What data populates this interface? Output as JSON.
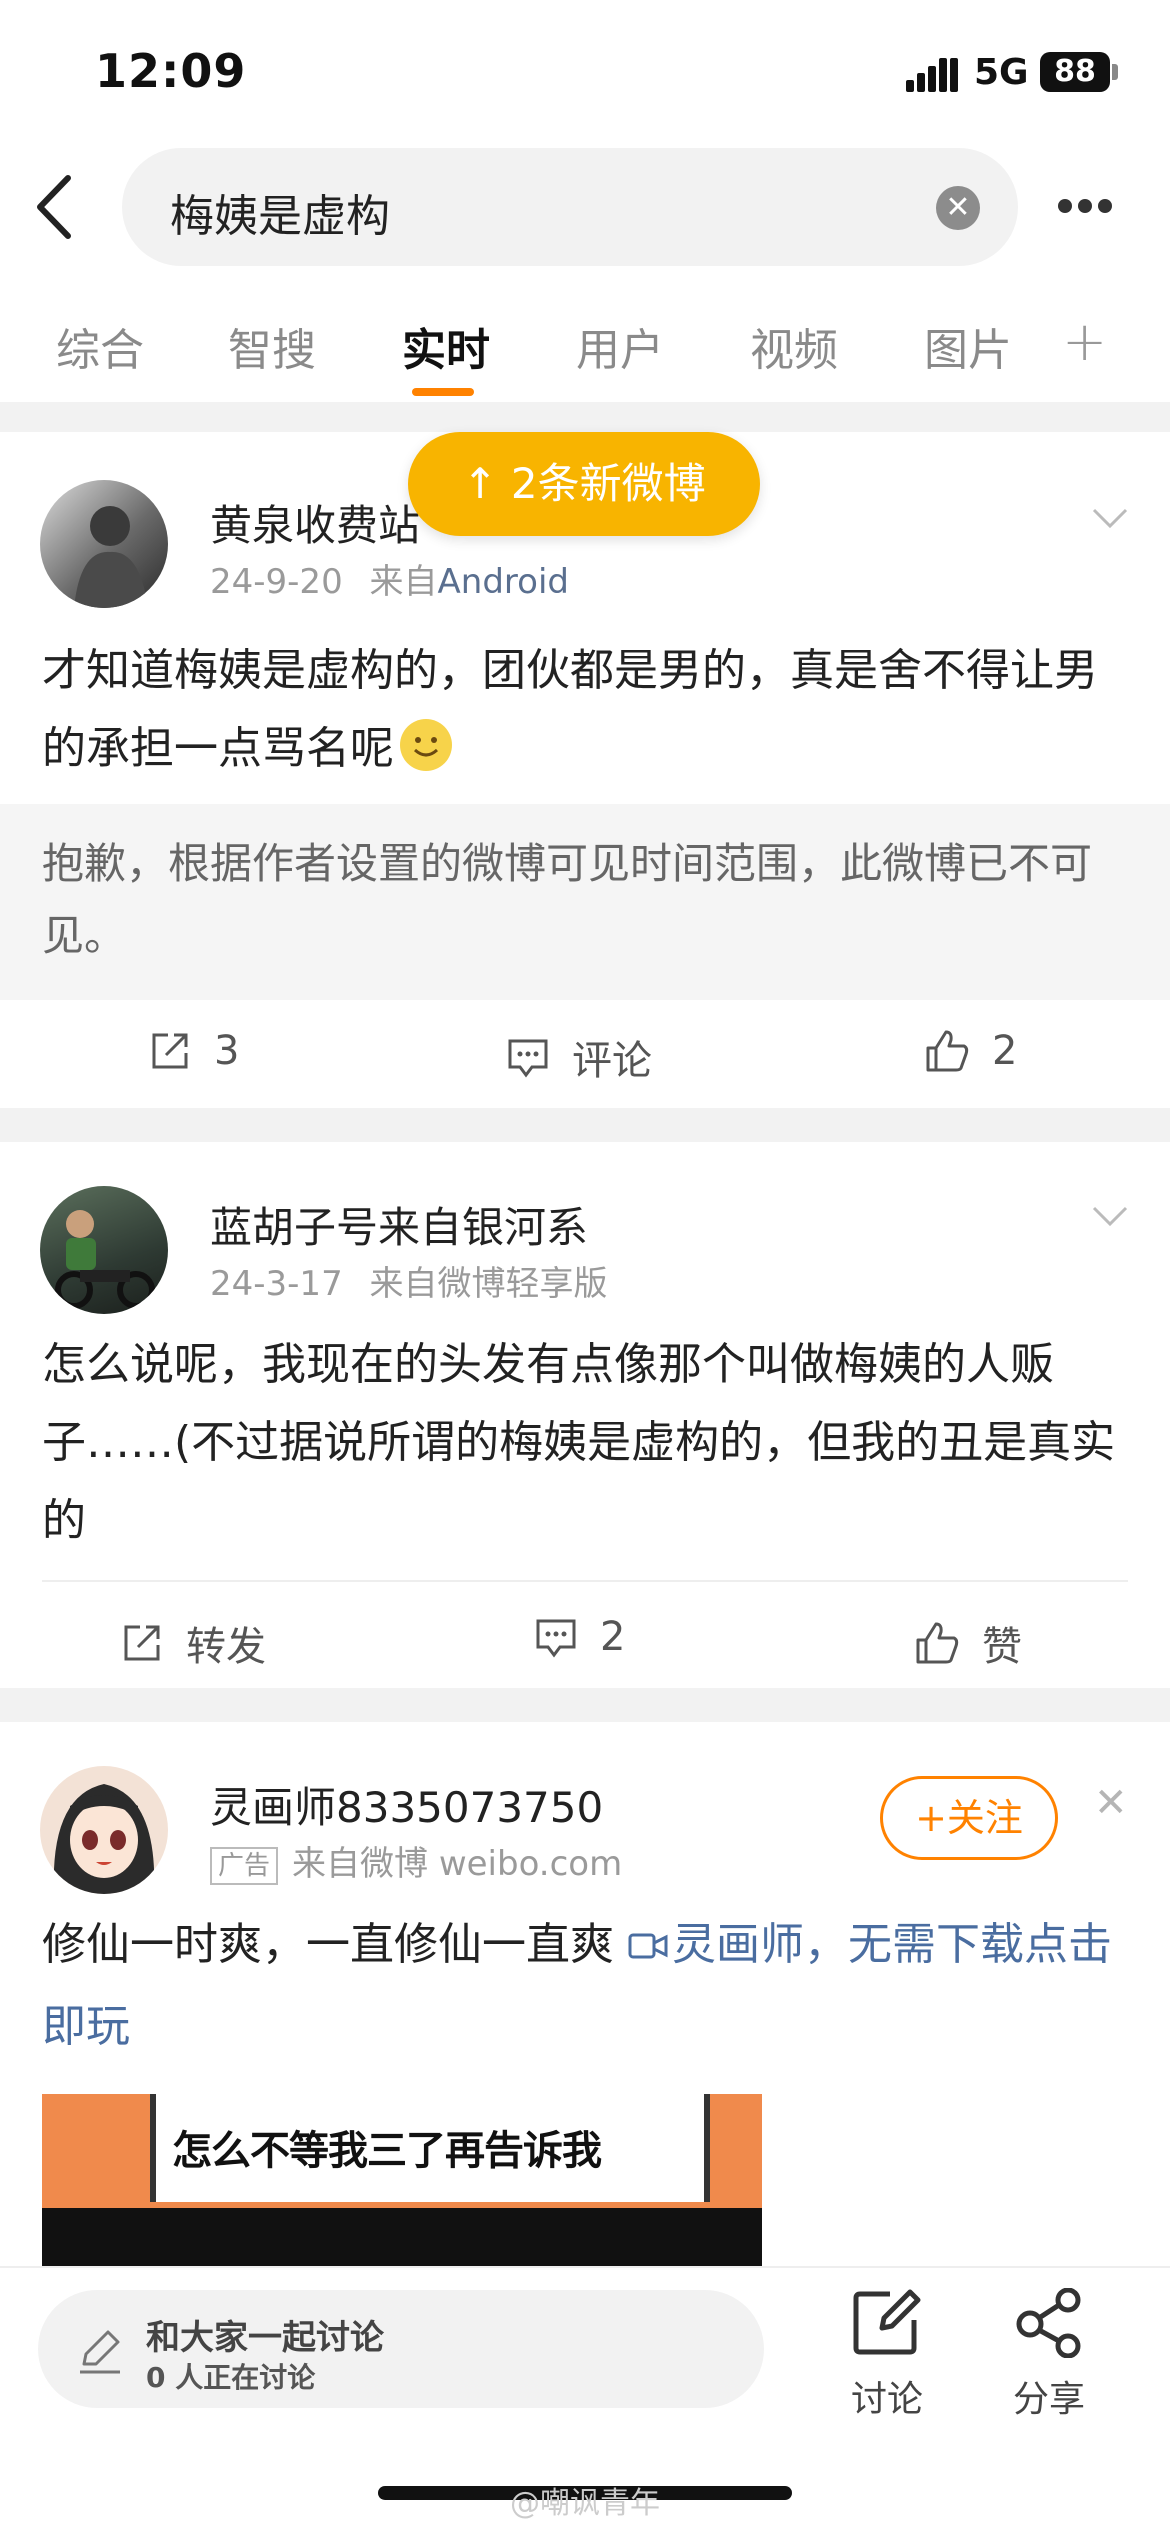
{
  "status_bar": {
    "time": "12:09",
    "network": "5G",
    "battery": "88"
  },
  "search": {
    "query": "梅姨是虚构"
  },
  "tabs": [
    {
      "label": "综合"
    },
    {
      "label": "智搜"
    },
    {
      "label": "实时"
    },
    {
      "label": "用户"
    },
    {
      "label": "视频"
    },
    {
      "label": "图片"
    }
  ],
  "active_tab": "实时",
  "new_posts": {
    "label": "↑ 2条新微博"
  },
  "posts": [
    {
      "author": "黄泉收费站",
      "date": "24-9-20",
      "source_prefix": "来自",
      "source": "Android",
      "text": "才知道梅姨是虚构的，团伙都是男的，真是舍不得让男的承担一点骂名呢",
      "notice": "抱歉，根据作者设置的微博可见时间范围，此微博已不可见。",
      "repost": "3",
      "comment": "评论",
      "like": "2"
    },
    {
      "author": "蓝胡子号来自银河系",
      "date": "24-3-17",
      "source_prefix": "来自",
      "source": "微博轻享版",
      "text": "怎么说呢，我现在的头发有点像那个叫做梅姨的人贩子……(不过据说所谓的梅姨是虚构的，但我的丑是真实的",
      "repost": "转发",
      "comment": "2",
      "like": "赞"
    },
    {
      "author": "灵画师8335073750",
      "ad_tag": "广告",
      "source": "来自微博 weibo.com",
      "follow": "+关注",
      "text": "修仙一时爽，一直修仙一直爽 ",
      "link": "灵画师，无需下载点击即玩",
      "image_caption": "怎么不等我三了再告诉我"
    }
  ],
  "bottom_bar": {
    "input_title": "和大家一起讨论",
    "input_sub": "0 人正在讨论",
    "discuss": "讨论",
    "share": "分享"
  },
  "watermark": "@嘲讽青年",
  "colors": {
    "accent": "#ff8200",
    "pill": "#f8b400",
    "link": "#4a6da0"
  },
  "icons": [
    "signal-icon",
    "back-arrow-icon",
    "clear-icon",
    "more-icon",
    "plus-icon",
    "chevron-down-icon",
    "repost-icon",
    "comment-icon",
    "like-icon",
    "smile-emoji-icon",
    "video-link-icon",
    "pencil-icon",
    "discuss-icon",
    "share-icon"
  ]
}
